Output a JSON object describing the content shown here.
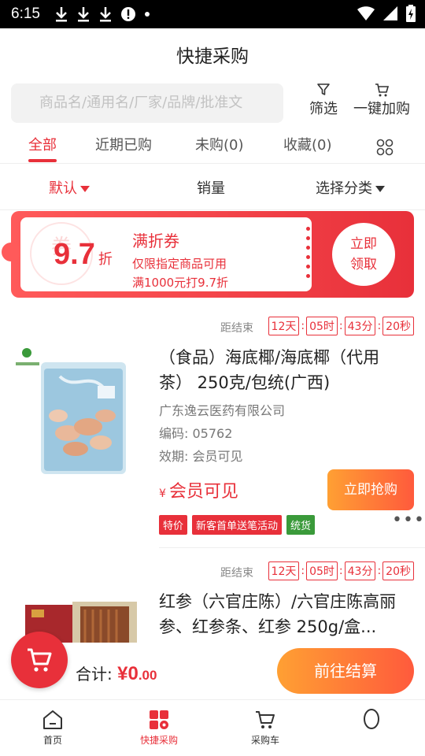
{
  "status": {
    "time": "6:15"
  },
  "header": {
    "title": "快捷采购"
  },
  "search": {
    "placeholder": "商品名/通用名/厂家/品牌/批准文"
  },
  "tools": {
    "filter_label": "筛选",
    "add_all_label": "一键加购"
  },
  "tabs": [
    {
      "label": "全部"
    },
    {
      "label": "近期已购"
    },
    {
      "label": "未购(0)"
    },
    {
      "label": "收藏(0)"
    }
  ],
  "sort": {
    "default_label": "默认",
    "sales_label": "销量",
    "category_label": "选择分类"
  },
  "coupon": {
    "watermark": "券",
    "discount": "9.7",
    "discount_unit": "折",
    "title": "满折券",
    "line1": "仅限指定商品可用",
    "line2": "满1000元打9.7折",
    "claim_line1": "立即",
    "claim_line2": "领取"
  },
  "products": [
    {
      "countdown": {
        "label": "距结束",
        "days": "12天",
        "hours": "05时",
        "minutes": "43分",
        "seconds": "20秒"
      },
      "name": "（食品）海底椰/海底椰（代用茶） 250克/包统(广西)",
      "company": "广东逸云医药有限公司",
      "code": "编码: 05762",
      "expiry": "效期: 会员可见",
      "currency": "¥",
      "price": "会员可见",
      "buy_label": "立即抢购",
      "tags": [
        {
          "text": "特价",
          "color": "#e8303a"
        },
        {
          "text": "新客首单送笔活动",
          "color": "#e8303a"
        },
        {
          "text": "统货",
          "color": "#3a9a3a"
        }
      ],
      "more": "•••"
    },
    {
      "countdown": {
        "label": "距结束",
        "days": "12天",
        "hours": "05时",
        "minutes": "43分",
        "seconds": "20秒"
      },
      "name": "红参（六官庄陈）/六官庄陈高丽参、红参条、红参 250g/盒..."
    }
  ],
  "checkout": {
    "total_label": "合计:",
    "currency": "¥",
    "amount_int": "0",
    "amount_dec": ".00",
    "go_label": "前往结算"
  },
  "nav": [
    {
      "label": "首页"
    },
    {
      "label": "快捷采购"
    },
    {
      "label": "采购车"
    }
  ],
  "colors": {
    "accent": "#e8303a",
    "orange": "#ff8a35",
    "green": "#3a9a3a"
  }
}
